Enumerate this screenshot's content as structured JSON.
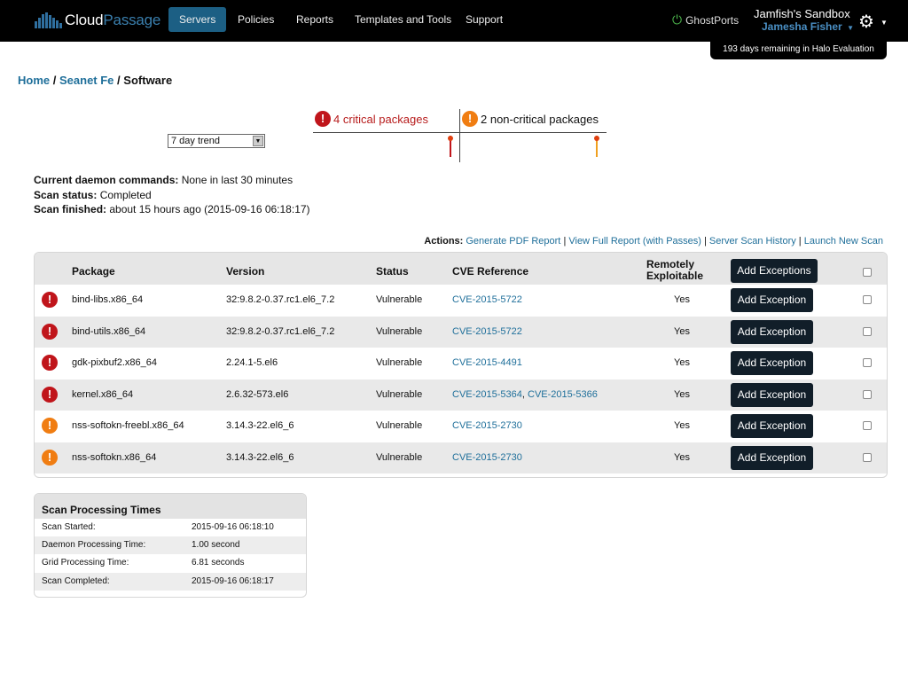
{
  "brand": {
    "part1": "Cloud",
    "part2": "Passage"
  },
  "nav": [
    {
      "label": "Servers",
      "active": true
    },
    {
      "label": "Policies",
      "active": false
    },
    {
      "label": "Reports",
      "active": false
    },
    {
      "label": "Templates and Tools",
      "active": false
    },
    {
      "label": "Support",
      "active": false
    }
  ],
  "ghost": {
    "label": "GhostPorts",
    "icon": "power-icon"
  },
  "account": {
    "name": "Jamfish's Sandbox",
    "user": "Jamesha Fisher"
  },
  "evaluation": "193 days remaining in Halo Evaluation",
  "breadcrumb": {
    "home": "Home",
    "server": "Seanet Fe",
    "current": "Software",
    "sep": "/"
  },
  "trend": {
    "selected": "7 day trend"
  },
  "summary": {
    "critical": "4 critical packages",
    "noncritical": "2 non-critical packages"
  },
  "status": {
    "daemon_label": "Current daemon commands:",
    "daemon_value": "None in last 30 minutes",
    "scan_label": "Scan status:",
    "scan_value": "Completed",
    "finished_label": "Scan finished:",
    "finished_value": "about 15 hours ago (2015-09-16 06:18:17)"
  },
  "actions": {
    "label": "Actions:",
    "pdf": "Generate PDF Report",
    "full": "View Full Report (with Passes)",
    "history": "Server Scan History",
    "launch": "Launch New Scan",
    "sep": "|"
  },
  "table": {
    "headers": {
      "package": "Package",
      "version": "Version",
      "status": "Status",
      "cve": "CVE Reference",
      "remote1": "Remotely",
      "remote2": "Exploitable",
      "add_all": "Add Exceptions"
    },
    "rows": [
      {
        "severity": "critical",
        "package": "bind-libs.x86_64",
        "version": "32:9.8.2-0.37.rc1.el6_7.2",
        "status": "Vulnerable",
        "cve1": "CVE-2015-5722",
        "cve2": "",
        "remote": "Yes",
        "button": "Add Exception"
      },
      {
        "severity": "critical",
        "package": "bind-utils.x86_64",
        "version": "32:9.8.2-0.37.rc1.el6_7.2",
        "status": "Vulnerable",
        "cve1": "CVE-2015-5722",
        "cve2": "",
        "remote": "Yes",
        "button": "Add Exception"
      },
      {
        "severity": "critical",
        "package": "gdk-pixbuf2.x86_64",
        "version": "2.24.1-5.el6",
        "status": "Vulnerable",
        "cve1": "CVE-2015-4491",
        "cve2": "",
        "remote": "Yes",
        "button": "Add Exception"
      },
      {
        "severity": "critical",
        "package": "kernel.x86_64",
        "version": "2.6.32-573.el6",
        "status": "Vulnerable",
        "cve1": "CVE-2015-5364",
        "cve2": "CVE-2015-5366",
        "remote": "Yes",
        "button": "Add Exception"
      },
      {
        "severity": "noncritical",
        "package": "nss-softokn-freebl.x86_64",
        "version": "3.14.3-22.el6_6",
        "status": "Vulnerable",
        "cve1": "CVE-2015-2730",
        "cve2": "",
        "remote": "Yes",
        "button": "Add Exception"
      },
      {
        "severity": "noncritical",
        "package": "nss-softokn.x86_64",
        "version": "3.14.3-22.el6_6",
        "status": "Vulnerable",
        "cve1": "CVE-2015-2730",
        "cve2": "",
        "remote": "Yes",
        "button": "Add Exception"
      }
    ]
  },
  "processing": {
    "title": "Scan Processing Times",
    "rows": [
      {
        "key": "Scan Started:",
        "value": "2015-09-16 06:18:10"
      },
      {
        "key": "Daemon Processing Time:",
        "value": "1.00 second"
      },
      {
        "key": "Grid Processing Time:",
        "value": "6.81 seconds"
      },
      {
        "key": "Scan Completed:",
        "value": "2015-09-16 06:18:17"
      }
    ]
  },
  "colors": {
    "critical": "#c0151b",
    "noncritical": "#f07d12",
    "link": "#1f6f9a",
    "nav_active": "#1c5f84"
  }
}
